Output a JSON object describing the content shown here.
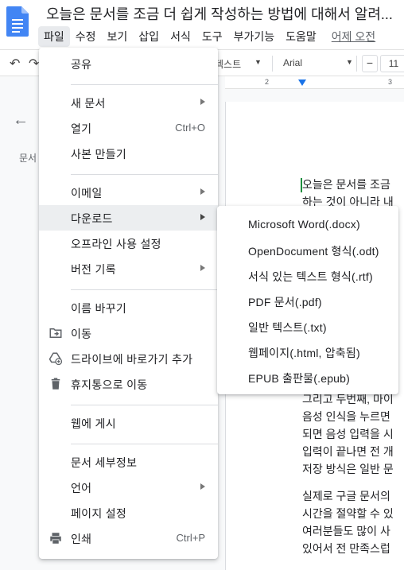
{
  "document": {
    "title": "오늘은 문서를 조금 더 쉽게 작성하는 방법에 대해서 알려..."
  },
  "menubar": {
    "items": [
      "파일",
      "수정",
      "보기",
      "삽입",
      "서식",
      "도구",
      "부가기능",
      "도움말"
    ],
    "last_edit": "어제 오전"
  },
  "toolbar": {
    "style_text": "텍스트",
    "font": "Arial",
    "minus_label": "−",
    "font_size": "11"
  },
  "ruler": {
    "tick_labels": [
      "2",
      "3"
    ]
  },
  "outline": {
    "label": "문서"
  },
  "file_menu": {
    "share": "공유",
    "new_doc": "새 문서",
    "open": "열기",
    "open_shortcut": "Ctrl+O",
    "copy": "사본 만들기",
    "email": "이메일",
    "download": "다운로드",
    "offline": "오프라인 사용 설정",
    "version_history": "버전 기록",
    "rename": "이름 바꾸기",
    "move": "이동",
    "add_shortcut": "드라이브에 바로가기 추가",
    "trash": "휴지통으로 이동",
    "publish": "웹에 게시",
    "details": "문서 세부정보",
    "language": "언어",
    "page_setup": "페이지 설정",
    "print": "인쇄",
    "print_shortcut": "Ctrl+P"
  },
  "download_menu": {
    "items": [
      "Microsoft Word(.docx)",
      "OpenDocument 형식(.odt)",
      "서식 있는 텍스트 형식(.rtf)",
      "PDF 문서(.pdf)",
      "일반 텍스트(.txt)",
      "웹페이지(.html, 압축됨)",
      "EPUB 출판물(.epub)"
    ]
  },
  "doc_body": {
    "lines": [
      "오늘은 문서를 조금",
      "하는 것이 아니라 내",
      "",
      "",
      "",
      "",
      "",
      "",
      "",
      "",
      "그리고 두번째, 마이",
      "음성 인식을 누르면",
      "되면 음성 입력을 시",
      "입력이 끝나면 전 개",
      "저장 방식은 일반 문",
      "실제로 구글 문서의",
      "시간을 절약할 수 있",
      "여러분들도 많이 사",
      "있어서 전 만족스럽"
    ]
  },
  "colors": {
    "accent": "#1a73e8",
    "doc_icon": "#4285f4",
    "highlight": "#eceef0"
  }
}
